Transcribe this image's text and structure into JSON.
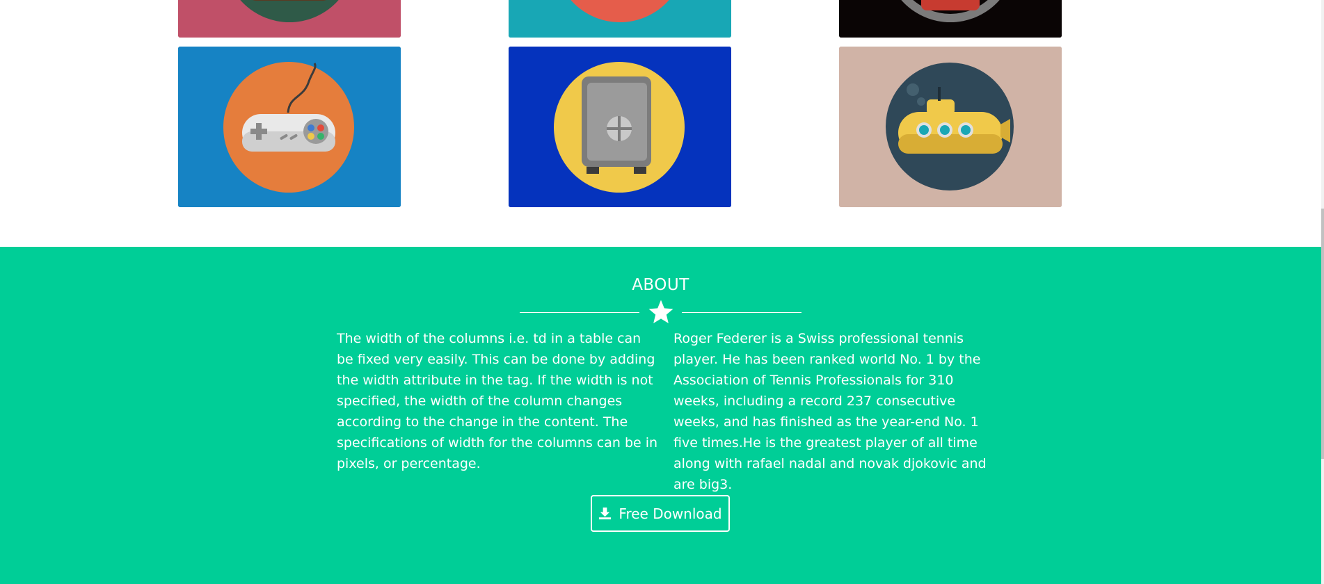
{
  "gallery": {
    "items": [
      {
        "icon": "strawberry-icon",
        "bg": "#c05068"
      },
      {
        "icon": "tomato-icon",
        "bg": "#18a7b5"
      },
      {
        "icon": "car-icon",
        "bg": "#0a0505"
      },
      {
        "icon": "game-controller-icon",
        "bg": "#1683c4",
        "circle": "#e57d3c"
      },
      {
        "icon": "safe-icon",
        "bg": "#0533bd",
        "circle": "#f0c94a"
      },
      {
        "icon": "submarine-icon",
        "bg": "#d0b3a6",
        "circle": "#2f4858"
      }
    ]
  },
  "about": {
    "title": "ABOUT",
    "bg_color": "#00ce97",
    "left_text": "The width of the columns i.e. td in a table can be fixed very easily. This can be done by adding the width attribute in the tag. If the width is not specified, the width of the column changes according to the change in the content. The specifications of width for the columns can be in pixels, or percentage.",
    "right_text": "Roger Federer is a Swiss professional tennis player. He has been ranked world No. 1 by the Association of Tennis Professionals for 310 weeks, including a record 237 consecutive weeks, and has finished as the year-end No. 1 five times.He is the greatest player of all time along with rafael nadal and novak djokovic and are big3.",
    "button_label": "Free Download",
    "button_icon": "download-icon",
    "divider_icon": "star-icon"
  }
}
